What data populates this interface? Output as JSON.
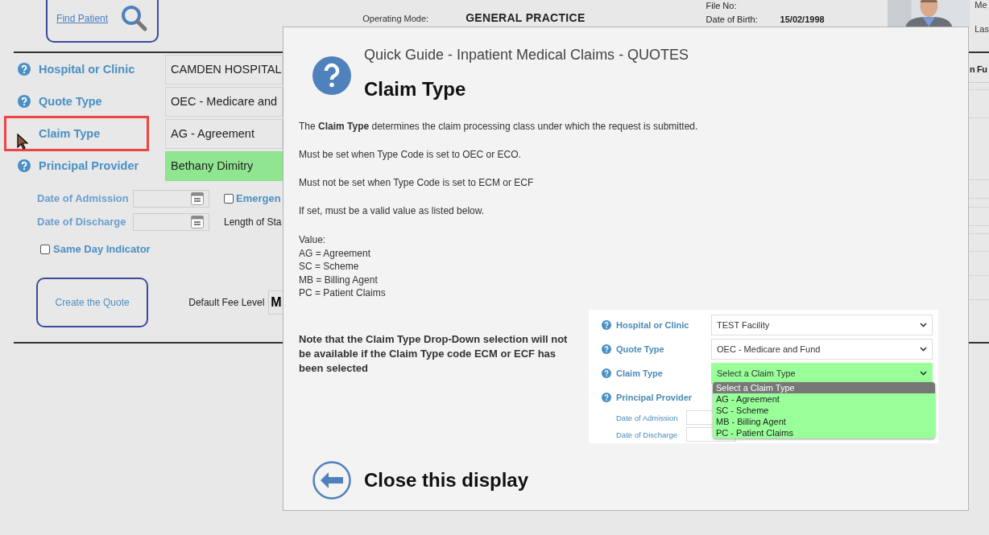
{
  "header": {
    "find_patient": "Find Patient",
    "operating_mode_label": "Operating Mode:",
    "operating_mode": "GENERAL PRACTICE",
    "file_no_label": "File No:",
    "dob_label": "Date of Birth:",
    "dob": "15/02/1998",
    "side_labels": [
      "Me",
      "Las"
    ]
  },
  "form": {
    "fields": [
      {
        "label": "Hospital or Clinic",
        "value": "CAMDEN HOSPITAL",
        "kind": "plain",
        "highlighted": false
      },
      {
        "label": "Quote Type",
        "value": "OEC - Medicare and",
        "kind": "plain",
        "highlighted": false
      },
      {
        "label": "Claim Type",
        "value": "AG - Agreement",
        "kind": "plain",
        "highlighted": true
      },
      {
        "label": "Principal Provider",
        "value": "Bethany Dimitry",
        "kind": "filled",
        "highlighted": false
      }
    ],
    "dates": [
      {
        "label": "Date of Admission",
        "side": {
          "kind": "checkbox",
          "label": "Emergen",
          "checked": false
        }
      },
      {
        "label": "Date of Discharge",
        "side": {
          "kind": "text",
          "label": "Length of Sta"
        }
      }
    ],
    "same_day": {
      "label": "Same Day Indicator",
      "checked": false
    },
    "create_button": "Create the Quote",
    "fee_level_label": "Default Fee Level",
    "fee_level": "M"
  },
  "side_column": {
    "heading": "n Fu"
  },
  "guide": {
    "title": "Quick Guide - Inpatient Medical Claims - QUOTES",
    "heading": "Claim Type",
    "paragraphs": [
      "The **Claim Type** determines the claim processing class under which the request is submitted.",
      "Must be set when Type Code is set to OEC or ECO.",
      "Must not be set when Type Code is set to ECM or ECF",
      "If set, must be a valid value as listed below."
    ],
    "values": [
      "Value:",
      "AG = Agreement",
      "SC = Scheme",
      "MB = Billing Agent",
      "PC = Patient Claims"
    ],
    "note": "Note that the Claim Type Drop-Down selection will not be available if the Claim Type code ECM or ECF has been selected",
    "example": {
      "fields": [
        {
          "label": "Hospital or Clinic",
          "value": "TEST Facility",
          "kind": "plain"
        },
        {
          "label": "Quote Type",
          "value": "OEC - Medicare and Fund",
          "kind": "plain"
        },
        {
          "label": "Claim Type",
          "value": "Select a Claim Type",
          "kind": "filled"
        },
        {
          "label": "Principal Provider",
          "kind": "none"
        }
      ],
      "dates": [
        "Date of Admission",
        "Date of Discharge"
      ],
      "options": [
        {
          "label": "Select a Claim Type",
          "selected": true
        },
        {
          "label": "AG - Agreement",
          "selected": false
        },
        {
          "label": "SC - Scheme",
          "selected": false
        },
        {
          "label": "MB - Billing Agent",
          "selected": false
        },
        {
          "label": "PC - Patient Claims",
          "selected": false
        }
      ]
    },
    "close": "Close this display"
  }
}
